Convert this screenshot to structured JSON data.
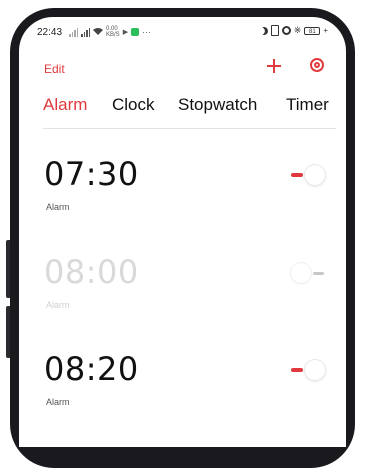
{
  "status_bar": {
    "time": "22:43",
    "speed_value": "0.00",
    "speed_unit": "KB/S",
    "battery": "81",
    "icons": [
      "signal-icon",
      "wifi-icon",
      "navigation-icon",
      "app-notification-icon",
      "more-icon",
      "do-not-disturb-icon",
      "vibrate-icon",
      "alarm-status-icon",
      "bluetooth-icon",
      "battery-icon",
      "charging-icon"
    ]
  },
  "toolbar": {
    "edit_label": "Edit",
    "add_icon": "plus-icon",
    "settings_icon": "settings-icon"
  },
  "tabs": [
    {
      "label": "Alarm",
      "active": true
    },
    {
      "label": "Clock",
      "active": false
    },
    {
      "label": "Stopwatch",
      "active": false
    },
    {
      "label": "Timer",
      "active": false
    }
  ],
  "alarms": [
    {
      "time": "07:30",
      "label": "Alarm",
      "enabled": true
    },
    {
      "time": "08:00",
      "label": "Alarm",
      "enabled": false
    },
    {
      "time": "08:20",
      "label": "Alarm",
      "enabled": true
    }
  ],
  "colors": {
    "accent": "#e03a3e",
    "text": "#111111",
    "disabled_text": "#d9d9d9"
  }
}
